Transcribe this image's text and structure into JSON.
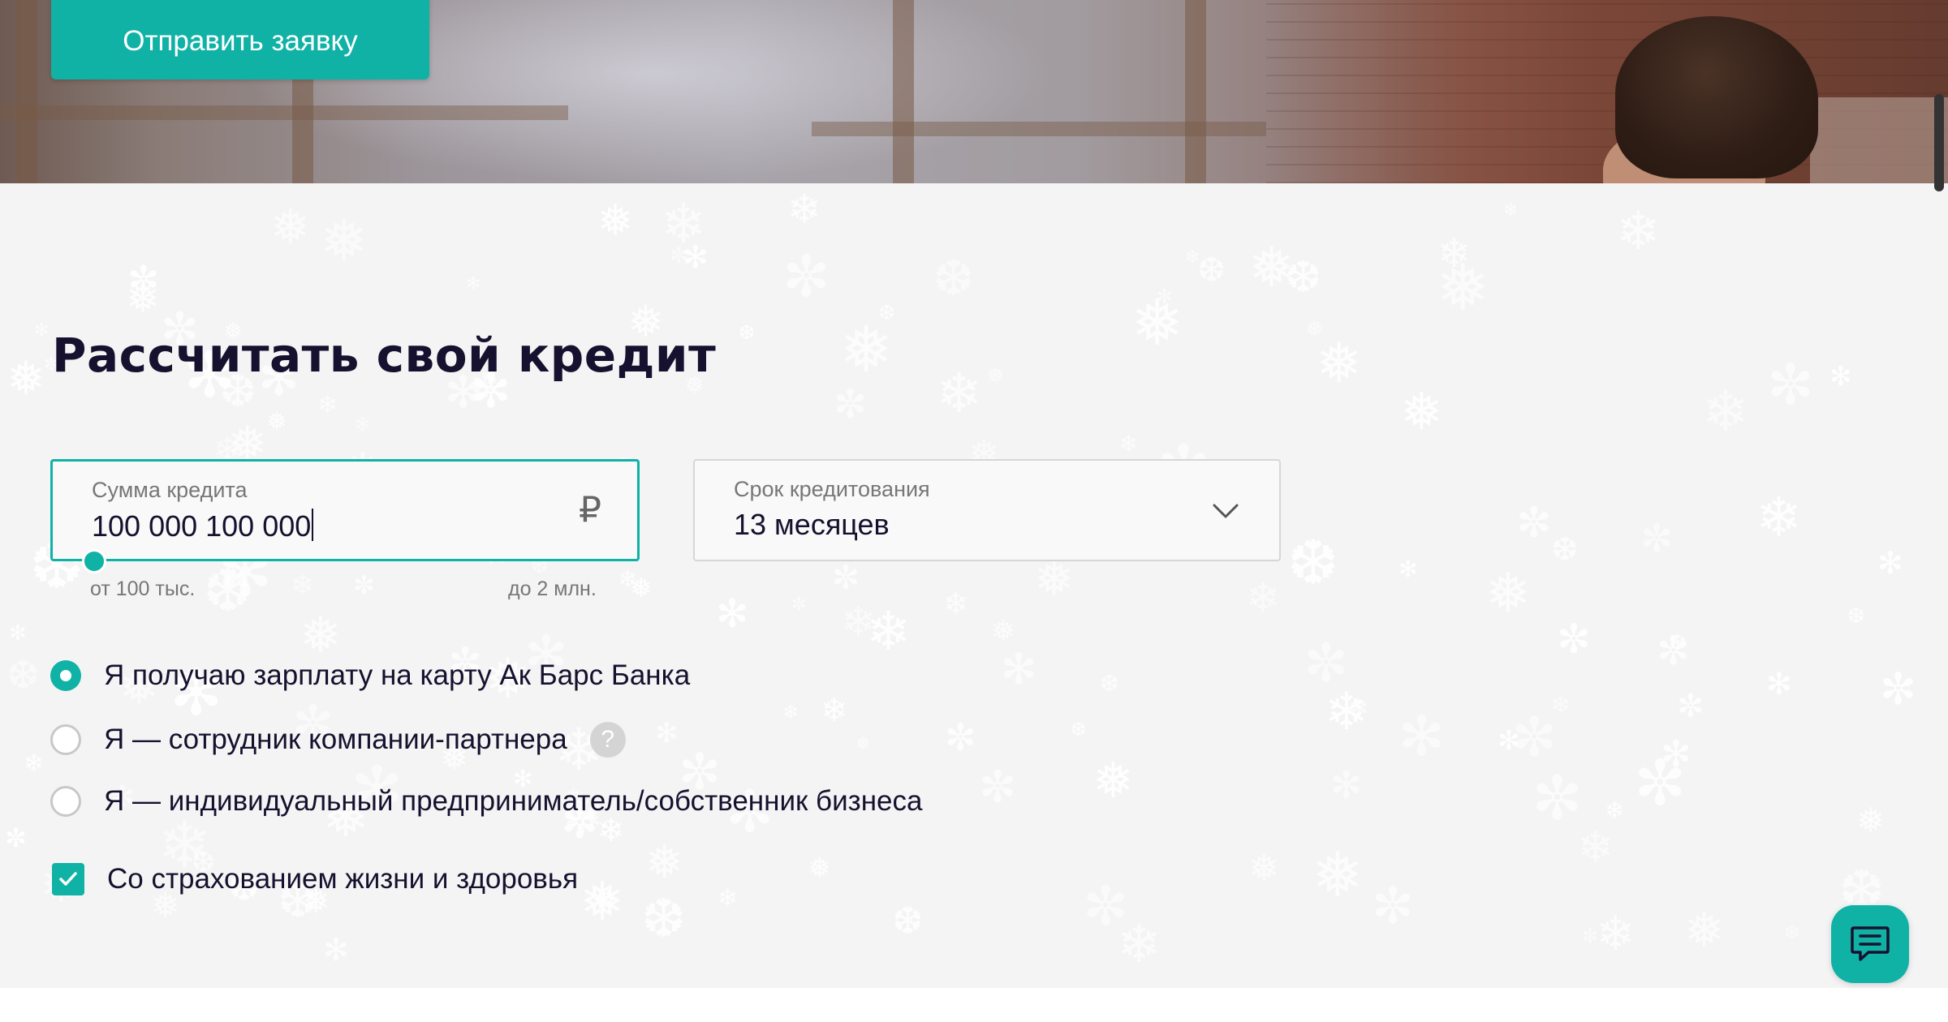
{
  "hero": {
    "cta_label": "Отправить заявку"
  },
  "calculator": {
    "title": "Рассчитать свой кредит",
    "amount_field": {
      "label": "Сумма кредита",
      "value": "100 000 100 000",
      "currency_symbol": "₽"
    },
    "slider": {
      "min_label": "от 100 тыс.",
      "max_label": "до 2 млн."
    },
    "term_field": {
      "label": "Срок кредитования",
      "value": "13 месяцев"
    },
    "options": [
      {
        "label": "Я получаю зарплату на карту Ак Барс Банка",
        "selected": true
      },
      {
        "label": "Я — сотрудник компании-партнера",
        "selected": false,
        "help": "?"
      },
      {
        "label": "Я — индивидуальный предприниматель/собственник бизнеса",
        "selected": false
      }
    ],
    "insurance_checkbox": {
      "label": "Со страхованием жизни и здоровья",
      "checked": true
    }
  },
  "icons": {
    "currency": "ruble-icon",
    "dropdown": "chevron-down-icon",
    "help": "question-icon",
    "check": "checkmark-icon",
    "chat": "chat-icon"
  },
  "colors": {
    "accent": "#10b2a6",
    "text": "#15112e",
    "muted": "#777777",
    "section_bg": "#f4f4f4"
  }
}
